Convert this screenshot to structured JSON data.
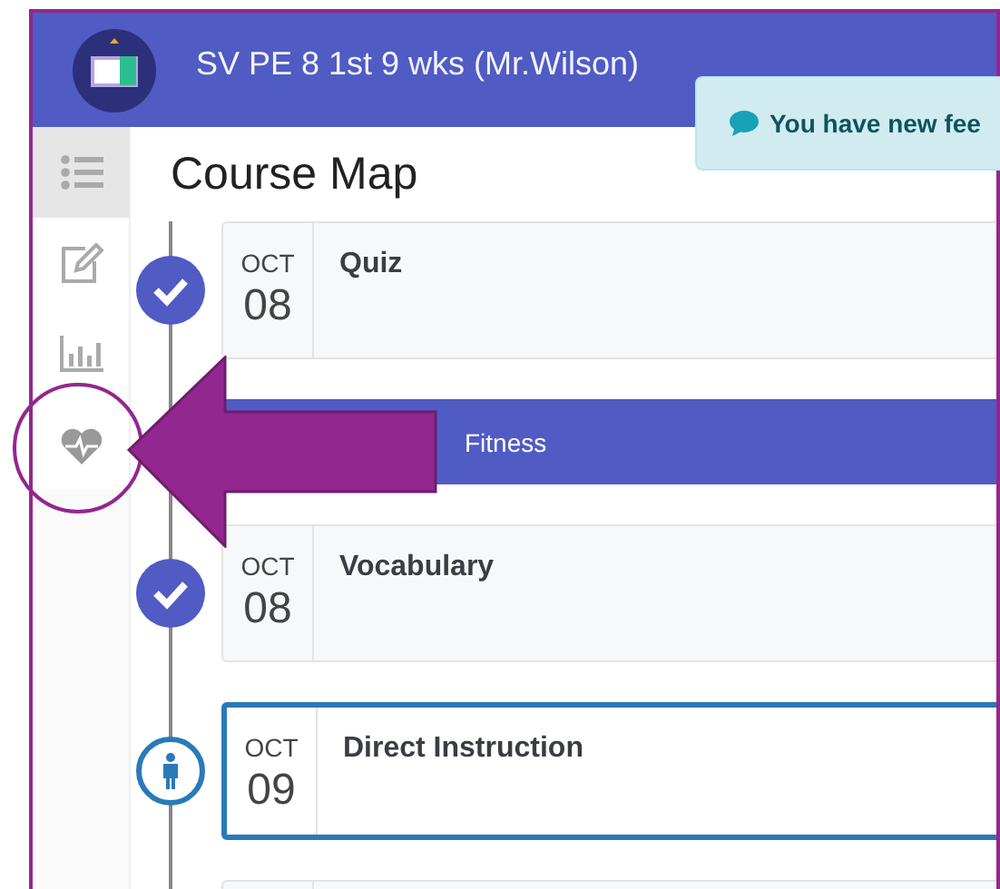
{
  "header": {
    "title": "SV PE 8 1st 9 wks (Mr.Wilson)"
  },
  "toast": {
    "text": "You have new fee"
  },
  "sidebar": {
    "items": [
      {
        "kind": "list",
        "selected": true,
        "highlighted": false
      },
      {
        "kind": "edit",
        "selected": false,
        "highlighted": false
      },
      {
        "kind": "chart",
        "selected": false,
        "highlighted": false
      },
      {
        "kind": "health",
        "selected": false,
        "highlighted": true
      }
    ]
  },
  "page_title": "Course Map",
  "timeline": [
    {
      "kind": "activity",
      "completed": true,
      "month": "OCT",
      "day": "08",
      "title": "Quiz",
      "selected": false
    },
    {
      "kind": "unit",
      "title": "Fitness"
    },
    {
      "kind": "activity",
      "completed": true,
      "month": "OCT",
      "day": "08",
      "title": "Vocabulary",
      "selected": false
    },
    {
      "kind": "activity",
      "completed": false,
      "month": "OCT",
      "day": "09",
      "title": "Direct Instruction",
      "selected": true
    },
    {
      "kind": "activity",
      "completed": false,
      "selected": false
    }
  ]
}
